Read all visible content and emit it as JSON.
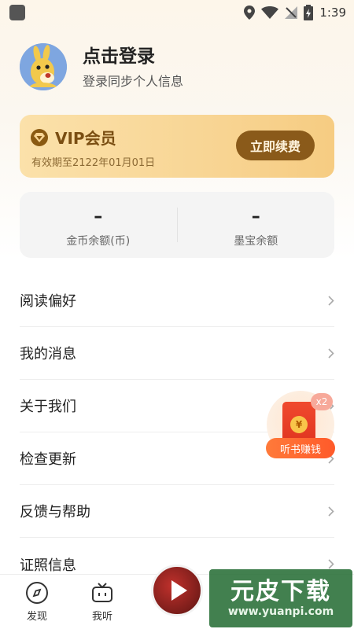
{
  "status_bar": {
    "time": "1:39"
  },
  "profile": {
    "title": "点击登录",
    "subtitle": "登录同步个人信息",
    "avatar_icon": "kangaroo-mascot-icon"
  },
  "vip": {
    "title": "VIP会员",
    "expiry": "有效期至2122年01月01日",
    "renew_label": "立即续费",
    "icon": "diamond-icon"
  },
  "balances": [
    {
      "value": "–",
      "label": "金币余额(币)"
    },
    {
      "value": "–",
      "label": "墨宝余额"
    }
  ],
  "menu": [
    {
      "label": "阅读偏好"
    },
    {
      "label": "我的消息"
    },
    {
      "label": "关于我们"
    },
    {
      "label": "检查更新"
    },
    {
      "label": "反馈与帮助"
    },
    {
      "label": "证照信息"
    }
  ],
  "float_reward": {
    "badge": "x2",
    "label": "听书赚钱",
    "coin": "¥"
  },
  "bottom_nav": [
    {
      "label": "发现",
      "icon": "compass-icon"
    },
    {
      "label": "我听",
      "icon": "radio-tv-icon"
    }
  ],
  "watermark": {
    "title": "元皮下载",
    "url": "www.yuanpi.com"
  },
  "colors": {
    "vip_gold": "#f8d594",
    "vip_brown": "#8a5a1a",
    "reward_orange": "#ff6a32"
  }
}
